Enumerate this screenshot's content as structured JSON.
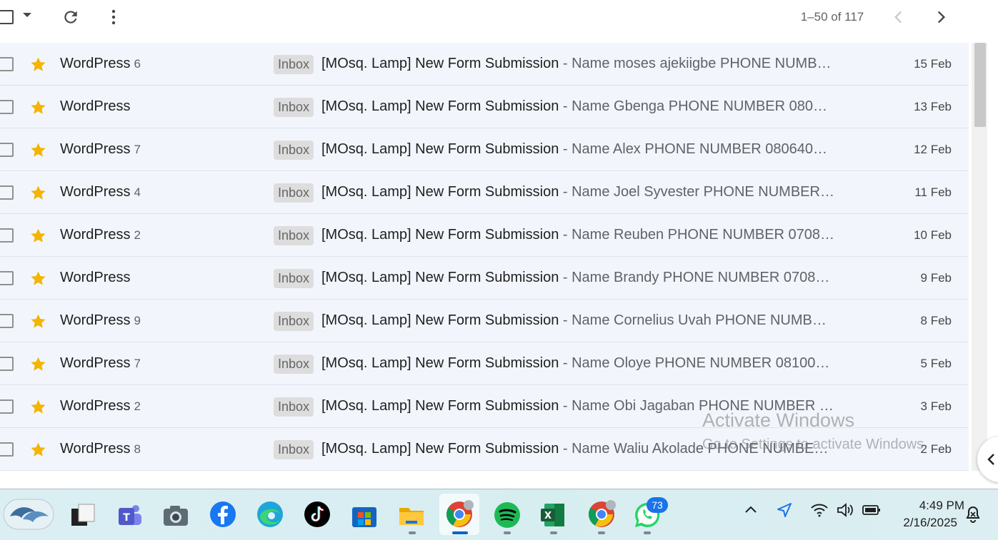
{
  "toolbar": {
    "pager_text": "1–50 of 117"
  },
  "rows": [
    {
      "sender": "WordPress",
      "count": "6",
      "label": "Inbox",
      "subject": "[MOsq. Lamp] New Form Submission",
      "snippet": " - Name moses ajekiigbe PHONE NUMB…",
      "date": "15 Feb"
    },
    {
      "sender": "WordPress",
      "count": "",
      "label": "Inbox",
      "subject": "[MOsq. Lamp] New Form Submission",
      "snippet": " - Name Gbenga PHONE NUMBER 080…",
      "date": "13 Feb"
    },
    {
      "sender": "WordPress",
      "count": "7",
      "label": "Inbox",
      "subject": "[MOsq. Lamp] New Form Submission",
      "snippet": " - Name Alex PHONE NUMBER 080640…",
      "date": "12 Feb"
    },
    {
      "sender": "WordPress",
      "count": "4",
      "label": "Inbox",
      "subject": "[MOsq. Lamp] New Form Submission",
      "snippet": " - Name Joel Syvester PHONE NUMBER…",
      "date": "11 Feb"
    },
    {
      "sender": "WordPress",
      "count": "2",
      "label": "Inbox",
      "subject": "[MOsq. Lamp] New Form Submission",
      "snippet": " - Name Reuben PHONE NUMBER 0708…",
      "date": "10 Feb"
    },
    {
      "sender": "WordPress",
      "count": "",
      "label": "Inbox",
      "subject": "[MOsq. Lamp] New Form Submission",
      "snippet": " - Name Brandy PHONE NUMBER 0708…",
      "date": "9 Feb"
    },
    {
      "sender": "WordPress",
      "count": "9",
      "label": "Inbox",
      "subject": "[MOsq. Lamp] New Form Submission",
      "snippet": " - Name Cornelius Uvah PHONE NUMB…",
      "date": "8 Feb"
    },
    {
      "sender": "WordPress",
      "count": "7",
      "label": "Inbox",
      "subject": "[MOsq. Lamp] New Form Submission",
      "snippet": " - Name Oloye PHONE NUMBER 08100…",
      "date": "5 Feb"
    },
    {
      "sender": "WordPress",
      "count": "2",
      "label": "Inbox",
      "subject": "[MOsq. Lamp] New Form Submission",
      "snippet": " - Name Obi Jagaban PHONE NUMBER …",
      "date": "3 Feb"
    },
    {
      "sender": "WordPress",
      "count": "8",
      "label": "Inbox",
      "subject": "[MOsq. Lamp] New Form Submission",
      "snippet": " - Name Waliu Akolade PHONE NUMBE…",
      "date": "2 Feb"
    }
  ],
  "watermark": {
    "line1": "Activate Windows",
    "line2": "Go to Settings to activate Windows."
  },
  "taskbar": {
    "apps": [
      "dolphin-widget",
      "task-view",
      "teams",
      "camera",
      "facebook",
      "edge",
      "tiktok",
      "microsoft-store",
      "file-explorer",
      "chrome",
      "spotify",
      "excel",
      "chrome",
      "whatsapp"
    ],
    "whatsapp_badge": "73",
    "time": "4:49 PM",
    "date": "2/16/2025"
  },
  "colors": {
    "star": "#f4b400",
    "row_bg": "#f2f6fc",
    "label_bg": "#dddddd"
  }
}
